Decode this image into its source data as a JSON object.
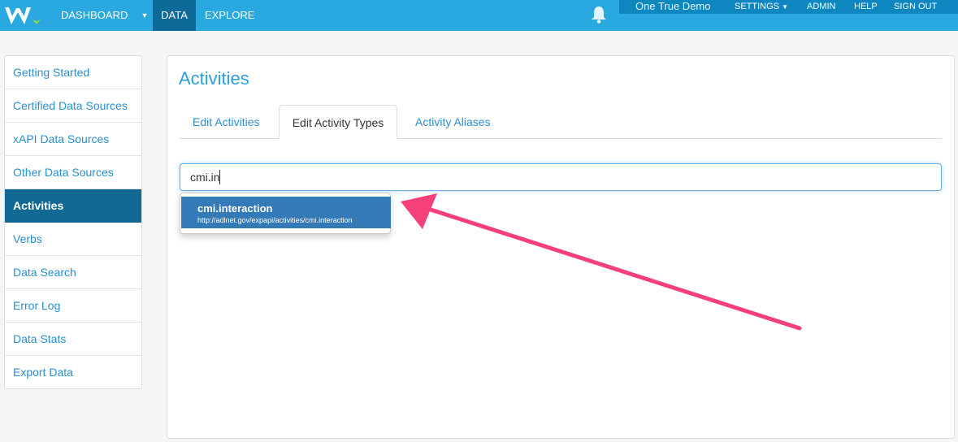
{
  "nav": {
    "dashboard": "DASHBOARD",
    "data": "DATA",
    "explore": "EXPLORE",
    "bell_icon": "bell-icon",
    "dropdown_icon": "caret-down-icon"
  },
  "user_bar": {
    "org": "One True Demo",
    "settings": "SETTINGS",
    "admin": "ADMIN",
    "help": "HELP",
    "signout": "SIGN OUT"
  },
  "sidebar": {
    "items": [
      {
        "label": "Getting Started"
      },
      {
        "label": "Certified Data Sources"
      },
      {
        "label": "xAPI Data Sources"
      },
      {
        "label": "Other Data Sources"
      },
      {
        "label": "Activities"
      },
      {
        "label": "Verbs"
      },
      {
        "label": "Data Search"
      },
      {
        "label": "Error Log"
      },
      {
        "label": "Data Stats"
      },
      {
        "label": "Export Data"
      }
    ],
    "active": "Activities"
  },
  "main": {
    "title": "Activities",
    "tabs": [
      {
        "label": "Edit Activities"
      },
      {
        "label": "Edit Activity Types"
      },
      {
        "label": "Activity Aliases"
      }
    ],
    "active_tab": "Edit Activity Types",
    "search": {
      "value": "cmi.in"
    },
    "suggestion": {
      "title": "cmi.interaction",
      "url": "http://adlnet.gov/expapi/activities/cmi.interaction"
    }
  },
  "colors": {
    "topbar": "#29a9e0",
    "active_nav": "#0e6a99",
    "sidebar_active": "#126a94",
    "link": "#2a8fcf",
    "suggestion_bg": "#337ab7",
    "annotation_arrow": "#f5407a"
  }
}
